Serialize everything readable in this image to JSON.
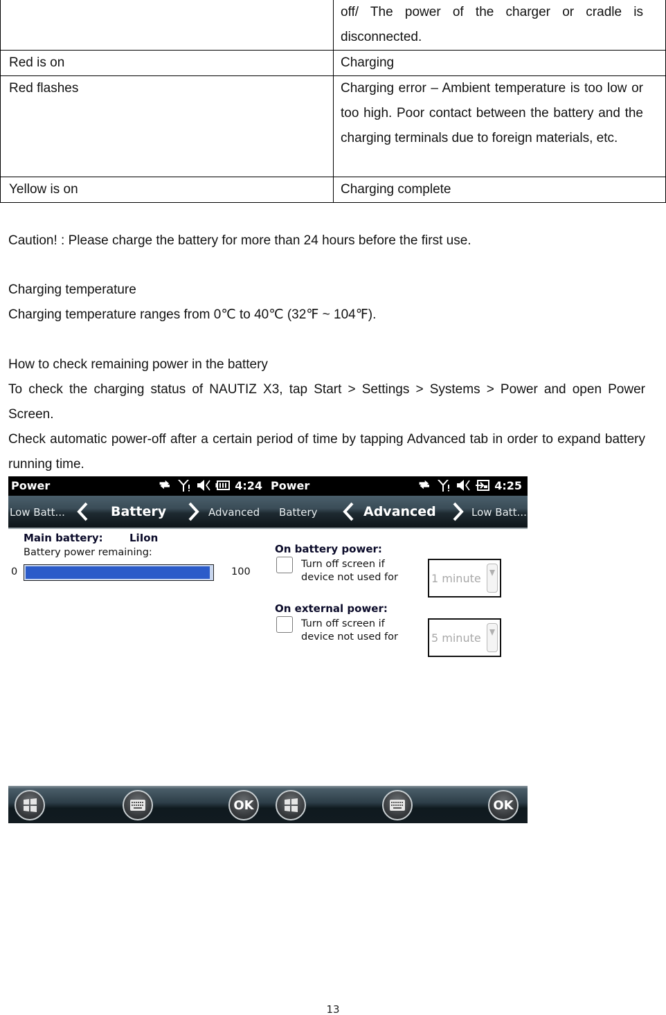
{
  "led_table": {
    "rows": [
      {
        "state": "",
        "meaning": "off/ The power of the charger or cradle is disconnected."
      },
      {
        "state": "Red is on",
        "meaning": "Charging"
      },
      {
        "state": "Red flashes",
        "meaning": "Charging error – Ambient temperature is too low or too high. Poor contact between the battery and the charging terminals due to foreign materials, etc."
      },
      {
        "state": "Yellow is on",
        "meaning": "Charging complete"
      }
    ]
  },
  "caution": "Caution! : Please charge the battery for more than 24 hours before the first use.",
  "charging_temperature": {
    "heading": "Charging temperature",
    "text": "Charging temperature ranges from 0℃ to 40℃ (32℉ ~ 104℉)."
  },
  "remaining_power": {
    "heading": "How to check remaining power in the battery",
    "text1": "To check the charging status of NAUTIZ X3, tap Start > Settings > Systems > Power and open Power Screen.",
    "text2": "Check automatic power-off after a certain period of time by tapping Advanced tab in order to expand battery running time."
  },
  "screens": {
    "battery": {
      "title": "Power",
      "time": "4:24",
      "status_icons": [
        "sync-icon",
        "signal-icon",
        "speaker-muted-icon",
        "battery-icon"
      ],
      "tab_prev": "Low Batt...",
      "tab_current": "Battery",
      "tab_next": "Advanced",
      "main_battery_label": "Main battery:",
      "main_battery_type": "LiIon",
      "remaining_label": "Battery power remaining:",
      "min_label": "0",
      "max_label": "100",
      "remaining_fraction": 0.99,
      "bottom_buttons": [
        "windows-start",
        "keyboard",
        "OK"
      ]
    },
    "advanced": {
      "title": "Power",
      "time": "4:25",
      "status_icons": [
        "sync-icon",
        "signal-icon",
        "speaker-muted-icon",
        "external-power-icon"
      ],
      "tab_prev": "Battery",
      "tab_current": "Advanced",
      "tab_next": "Low Batt...",
      "battery_section": "On battery power:",
      "battery_checkbox_label_1": "Turn off screen if",
      "battery_checkbox_label_2": "device not used for",
      "battery_checked": false,
      "battery_timeout": "1 minute",
      "external_section": "On external power:",
      "external_checkbox_label_1": "Turn off screen if",
      "external_checkbox_label_2": "device not used for",
      "external_checked": false,
      "external_timeout": "5 minute",
      "bottom_buttons": [
        "windows-start",
        "keyboard",
        "OK"
      ]
    },
    "ok_label": "OK"
  },
  "colors": {
    "progress_fill": "#2b5bc9",
    "title_bar": "#000000"
  },
  "page_number": "13"
}
